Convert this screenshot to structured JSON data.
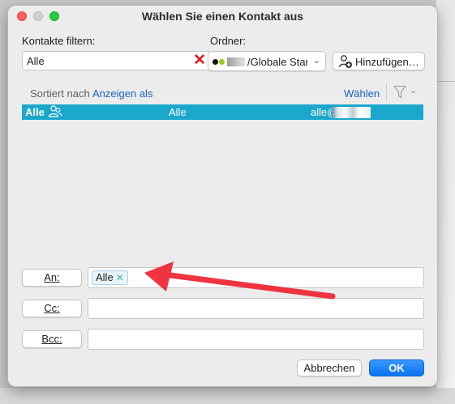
{
  "dialog": {
    "title": "Wählen Sie einen Kontakt aus"
  },
  "filter": {
    "label": "Kontakte filtern:",
    "value": "Alle"
  },
  "folder": {
    "label": "Ordner:",
    "selected": "/Globale Star"
  },
  "toolbar": {
    "add_label": "Hinzufügen…"
  },
  "list": {
    "sort_label": "Sortiert nach",
    "view_as_label": "Anzeigen als",
    "choose_label": "Wählen",
    "rows": [
      {
        "name": "Alle",
        "display": "Alle",
        "email": "alle@"
      }
    ]
  },
  "recipients": {
    "to": {
      "button_label": "An:",
      "tokens": [
        "Alle"
      ]
    },
    "cc": {
      "button_label": "Cc:",
      "tokens": []
    },
    "bcc": {
      "button_label": "Bcc:",
      "tokens": []
    }
  },
  "footer": {
    "cancel_label": "Abbrechen",
    "ok_label": "OK"
  },
  "colors": {
    "selection": "#1aa7cc",
    "link": "#1a62c9",
    "primary_button": "#0a74f0",
    "annotation_arrow": "#ef3340",
    "clear_icon": "#e4161b"
  }
}
